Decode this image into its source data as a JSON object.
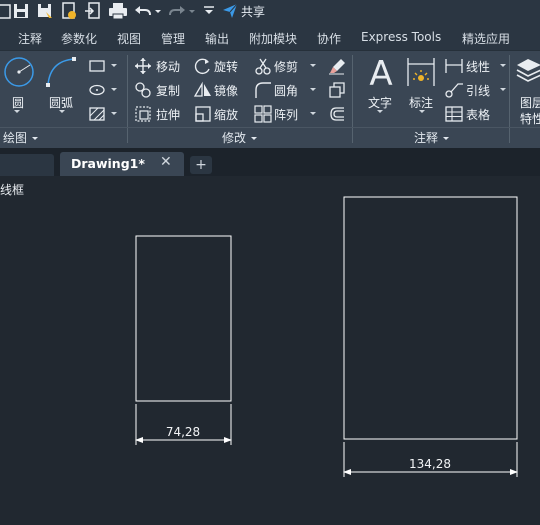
{
  "quick_access": {
    "share_label": "共享"
  },
  "ribbon_tabs": [
    "注释",
    "参数化",
    "视图",
    "管理",
    "输出",
    "附加模块",
    "协作",
    "Express Tools",
    "精选应用"
  ],
  "draw_panel": {
    "circle": "圆",
    "arc": "圆弧",
    "label": "绘图"
  },
  "modify_panel": {
    "move": "移动",
    "rotate": "旋转",
    "trim": "修剪",
    "copy": "复制",
    "mirror": "镜像",
    "fillet": "圆角",
    "stretch": "拉伸",
    "scale": "缩放",
    "array": "阵列",
    "label": "修改"
  },
  "annotation_panel": {
    "text": "文字",
    "dimension": "标注",
    "linear": "线性",
    "leader": "引线",
    "table": "表格",
    "label": "注释"
  },
  "properties_panel": {
    "line1": "图层",
    "line2": "特性"
  },
  "document": {
    "tab_title": "Drawing1*",
    "close_symbol": "✕",
    "new_tab_symbol": "+",
    "view_label": "线框"
  },
  "drawing": {
    "dim_small": "74,28",
    "dim_large": "134,28"
  },
  "colors": {
    "background": "#212830",
    "ribbon": "#3a4654",
    "accent": "#3b9ae8",
    "geometry": "#ffffff"
  }
}
